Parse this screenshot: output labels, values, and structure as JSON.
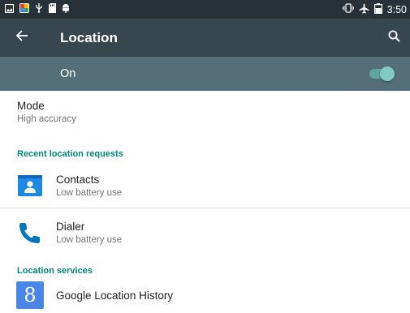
{
  "status_bar": {
    "time": "3:50",
    "left_icons": [
      "image-notification-icon",
      "photos-notification-icon",
      "usb-icon",
      "sd-card-icon",
      "android-debug-icon"
    ],
    "right_icons": [
      "vibrate-icon",
      "airplane-mode-icon",
      "battery-icon"
    ]
  },
  "app_bar": {
    "title": "Location",
    "back_icon": "arrow-back-icon",
    "search_icon": "search-icon"
  },
  "master_switch": {
    "label": "On",
    "checked": true
  },
  "mode": {
    "title": "Mode",
    "value": "High accuracy"
  },
  "recent_requests": {
    "header": "Recent location requests",
    "items": [
      {
        "name": "Contacts",
        "detail": "Low battery use",
        "icon": "contacts-icon"
      },
      {
        "name": "Dialer",
        "detail": "Low battery use",
        "icon": "dialer-icon"
      }
    ]
  },
  "location_services": {
    "header": "Location services",
    "items": [
      {
        "name": "Google Location History",
        "icon": "google-settings-icon",
        "icon_glyph": "8"
      }
    ]
  },
  "colors": {
    "status_bar": "#263238",
    "app_bar": "#37474f",
    "switch_bar": "#546e7a",
    "accent": "#00897b"
  }
}
